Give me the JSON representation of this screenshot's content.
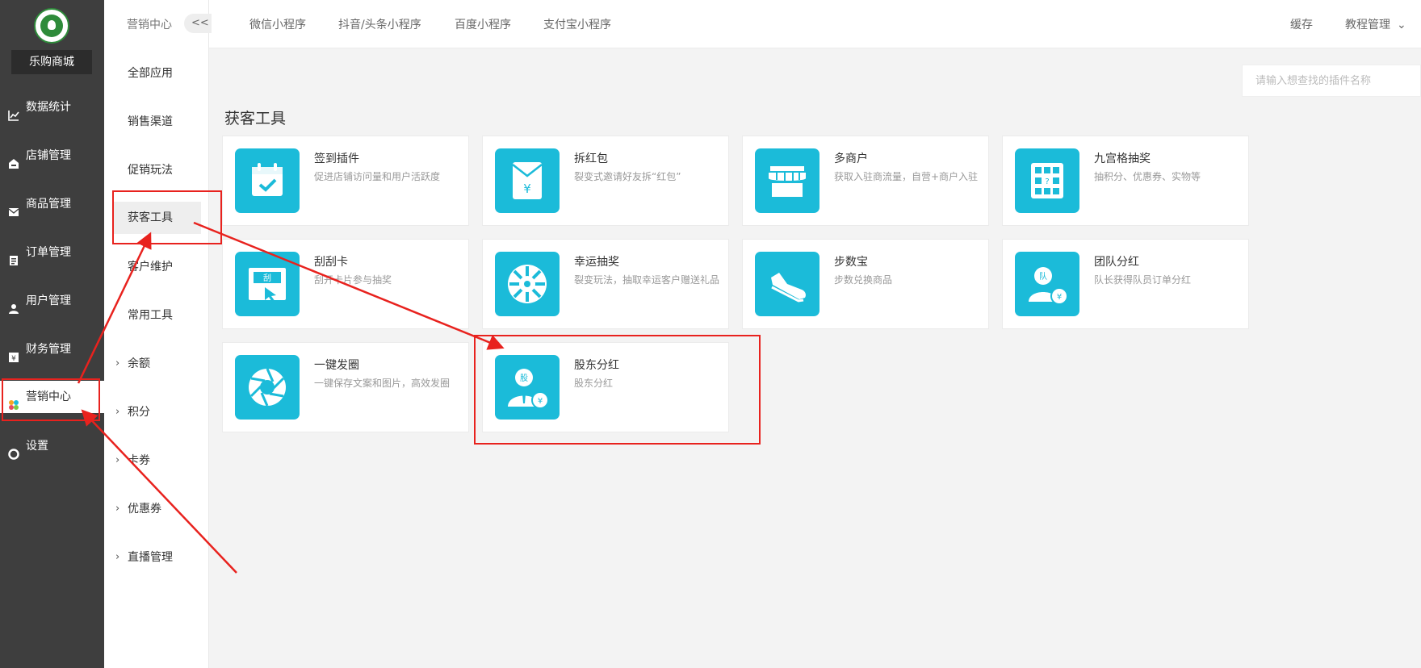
{
  "app": {
    "shop_name": "乐购商城"
  },
  "main_nav": [
    {
      "label": "数据统计",
      "icon": "line-chart-icon"
    },
    {
      "label": "店铺管理",
      "icon": "store-icon"
    },
    {
      "label": "商品管理",
      "icon": "envelope-icon"
    },
    {
      "label": "订单管理",
      "icon": "order-list-icon"
    },
    {
      "label": "用户管理",
      "icon": "user-icon"
    },
    {
      "label": "财务管理",
      "icon": "yuan-icon"
    },
    {
      "label": "营销中心",
      "icon": "colorful-dots-icon",
      "active": true
    },
    {
      "label": "设置",
      "icon": "gear-icon"
    }
  ],
  "sub_nav": {
    "title": "营销中心",
    "collapse_label": "<<",
    "items": [
      {
        "label": "全部应用"
      },
      {
        "label": "销售渠道"
      },
      {
        "label": "促销玩法"
      },
      {
        "label": "获客工具",
        "selected": true
      },
      {
        "label": "客户维护"
      },
      {
        "label": "常用工具"
      },
      {
        "label": "余额",
        "expandable": true
      },
      {
        "label": "积分",
        "expandable": true
      },
      {
        "label": "卡券",
        "expandable": true
      },
      {
        "label": "优惠券",
        "expandable": true
      },
      {
        "label": "直播管理",
        "expandable": true
      }
    ]
  },
  "header": {
    "tabs": [
      "微信小程序",
      "抖音/头条小程序",
      "百度小程序",
      "支付宝小程序"
    ],
    "right": {
      "cache": "缓存",
      "tutorial": "教程管理"
    }
  },
  "search": {
    "placeholder": "请输入想查找的插件名称"
  },
  "section": {
    "title": "获客工具"
  },
  "plugins": [
    {
      "name": "签到插件",
      "desc": "促进店铺访问量和用户活跃度",
      "icon": "calendar-check-icon"
    },
    {
      "name": "拆红包",
      "desc": "裂变式邀请好友拆“红包”",
      "icon": "red-envelope-icon"
    },
    {
      "name": "多商户",
      "desc": "获取入驻商流量，自营+商户入驻",
      "icon": "storefront-icon"
    },
    {
      "name": "九宫格抽奖",
      "desc": "抽积分、优惠券、实物等",
      "icon": "nine-grid-icon"
    },
    {
      "name": "刮刮卡",
      "desc": "刮开卡片参与抽奖",
      "icon": "scratch-card-icon"
    },
    {
      "name": "幸运抽奖",
      "desc": "裂变玩法，抽取幸运客户赠送礼品",
      "icon": "lucky-wheel-icon"
    },
    {
      "name": "步数宝",
      "desc": "步数兑换商品",
      "icon": "sneaker-icon"
    },
    {
      "name": "团队分红",
      "desc": "队长获得队员订单分红",
      "icon": "team-bonus-icon"
    },
    {
      "name": "一键发圈",
      "desc": "一键保存文案和图片，高效发圈",
      "icon": "aperture-icon"
    },
    {
      "name": "股东分红",
      "desc": "股东分红",
      "icon": "shareholder-icon"
    }
  ],
  "colors": {
    "accent": "#1bbbd9",
    "sidebar": "#3e3e3e",
    "annotation": "#e8221e"
  }
}
